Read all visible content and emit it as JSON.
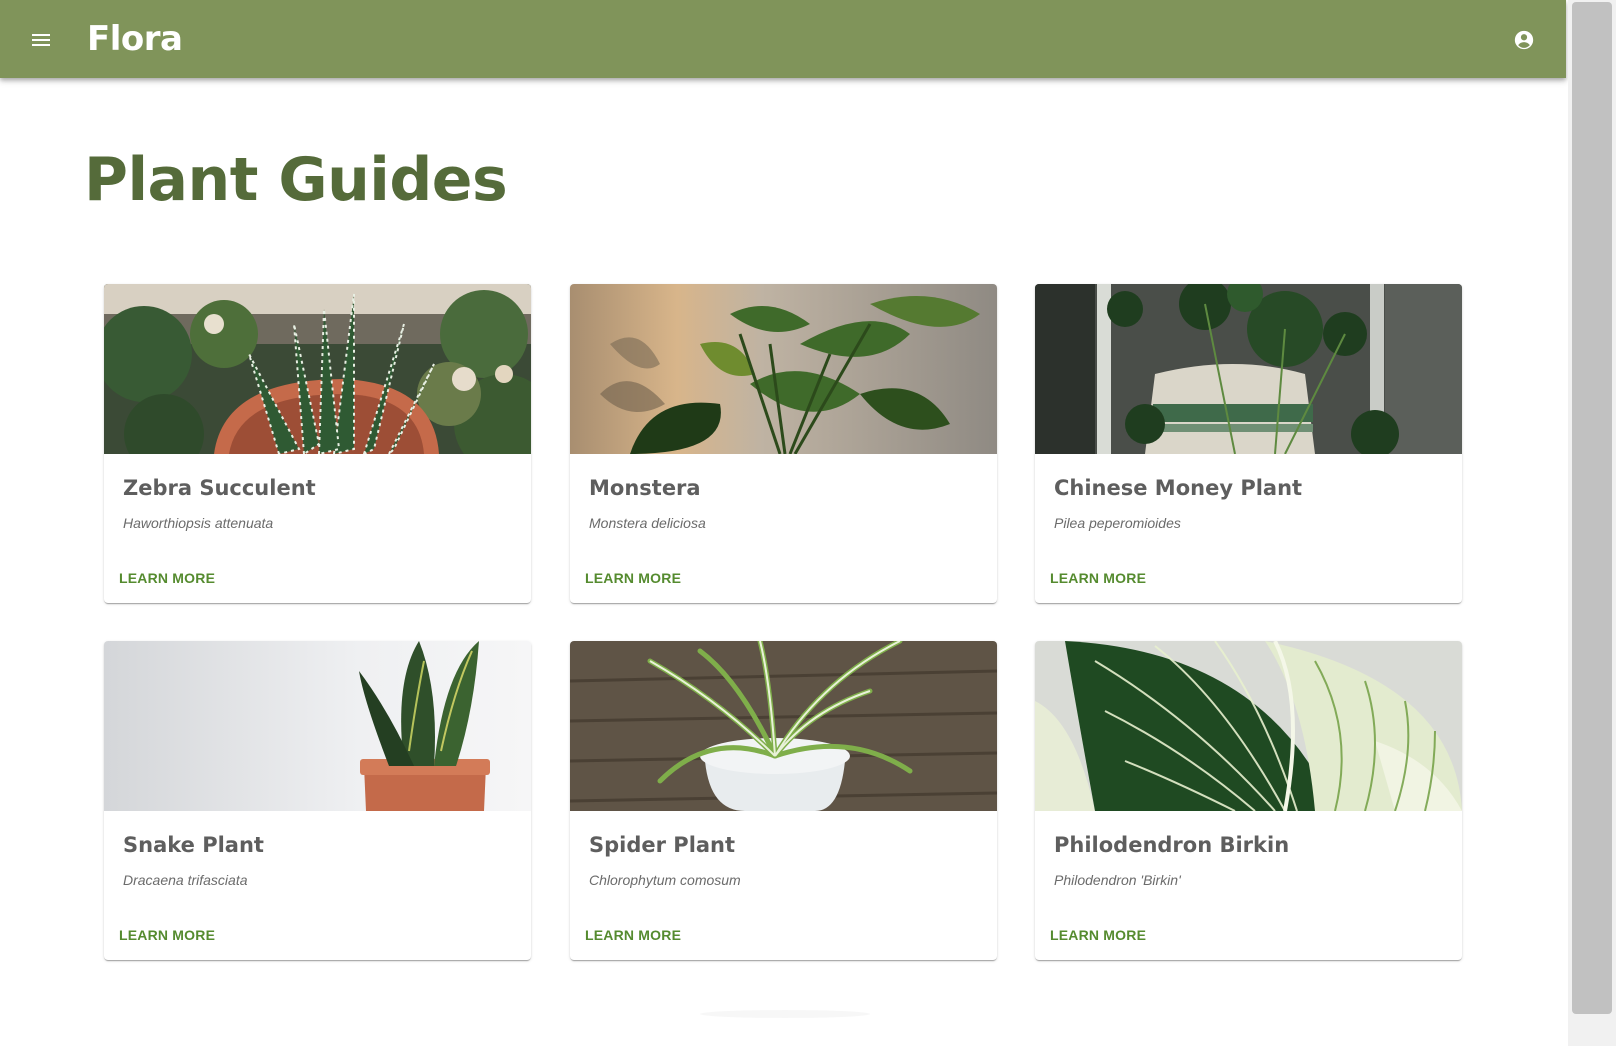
{
  "app": {
    "brand": "Flora"
  },
  "appbar": {
    "menu_icon": "menu-icon",
    "account_icon": "account-circle-icon",
    "background": "#80945a"
  },
  "page": {
    "title": "Plant Guides",
    "title_color": "#556b3a"
  },
  "cards": [
    {
      "name": "Zebra Succulent",
      "latin": "Haworthiopsis attenuata",
      "action": "LEARN MORE",
      "image": "zebra-succulent-photo"
    },
    {
      "name": "Monstera",
      "latin": "Monstera deliciosa",
      "action": "LEARN MORE",
      "image": "monstera-photo"
    },
    {
      "name": "Chinese Money Plant",
      "latin": "Pilea peperomioides",
      "action": "LEARN MORE",
      "image": "chinese-money-plant-photo"
    },
    {
      "name": "Snake Plant",
      "latin": "Dracaena trifasciata",
      "action": "LEARN MORE",
      "image": "snake-plant-photo"
    },
    {
      "name": "Spider Plant",
      "latin": "Chlorophytum comosum",
      "action": "LEARN MORE",
      "image": "spider-plant-photo"
    },
    {
      "name": "Philodendron Birkin",
      "latin": "Philodendron 'Birkin'",
      "action": "LEARN MORE",
      "image": "philodendron-birkin-photo"
    }
  ],
  "colors": {
    "accent": "#558b2f",
    "card_title": "#5e5e5e",
    "card_subtitle": "#6b6b6b"
  }
}
